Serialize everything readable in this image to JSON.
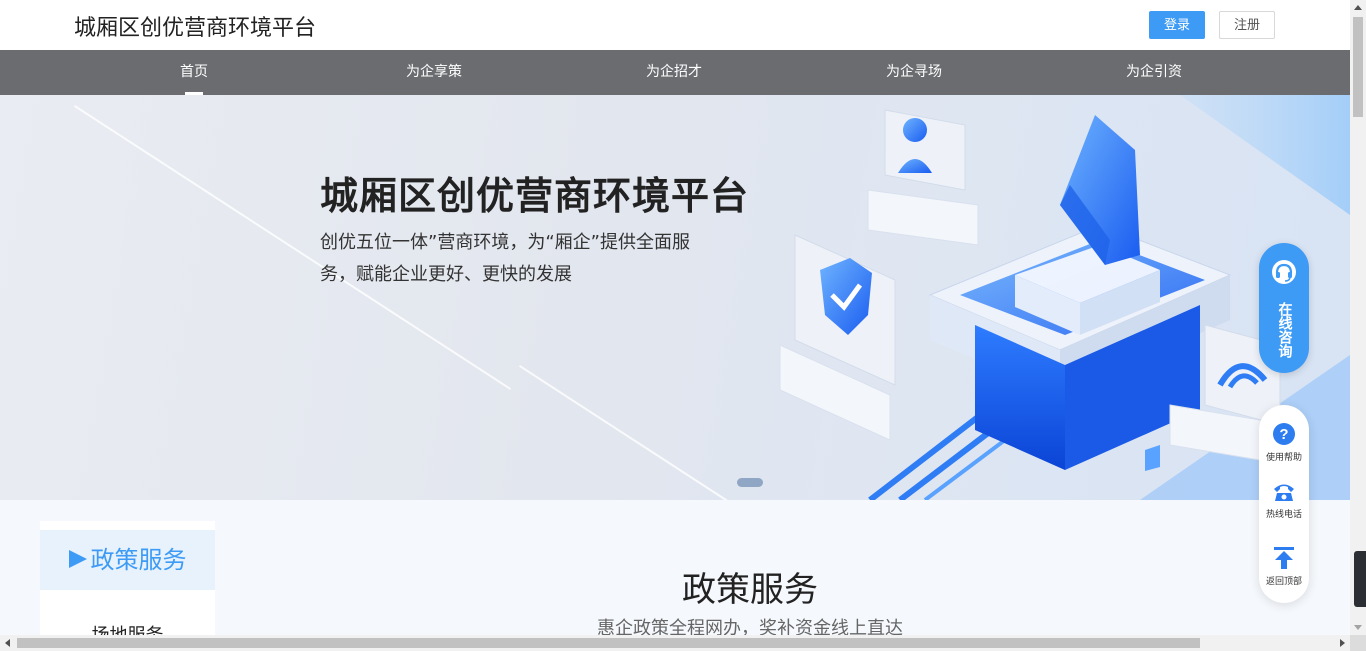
{
  "header": {
    "site_title": "城厢区创优营商环境平台",
    "login_label": "登录",
    "register_label": "注册"
  },
  "nav": {
    "items": [
      {
        "label": "首页",
        "active": true
      },
      {
        "label": "为企享策",
        "active": false
      },
      {
        "label": "为企招才",
        "active": false
      },
      {
        "label": "为企寻场",
        "active": false
      },
      {
        "label": "为企引资",
        "active": false
      }
    ]
  },
  "banner": {
    "title": "城厢区创优营商环境平台",
    "description": "创优五位一体”营商环境，为“厢企”提供全面服务，赋能企业更好、更快的发展"
  },
  "float_widgets": {
    "consult_label": "在线咨询",
    "tools": [
      {
        "label": "使用帮助",
        "icon": "help-icon"
      },
      {
        "label": "热线电话",
        "icon": "phone-icon"
      },
      {
        "label": "返回顶部",
        "icon": "back-to-top-icon"
      }
    ]
  },
  "content": {
    "side_menu": {
      "active_label": "政策服务",
      "items": [
        "场地服务"
      ]
    },
    "section_title": "政策服务",
    "section_subtitle": "惠企政策全程网办，奖补资金线上直达"
  },
  "colors": {
    "accent": "#3d9bf5",
    "nav_bg": "#6a6c70"
  }
}
